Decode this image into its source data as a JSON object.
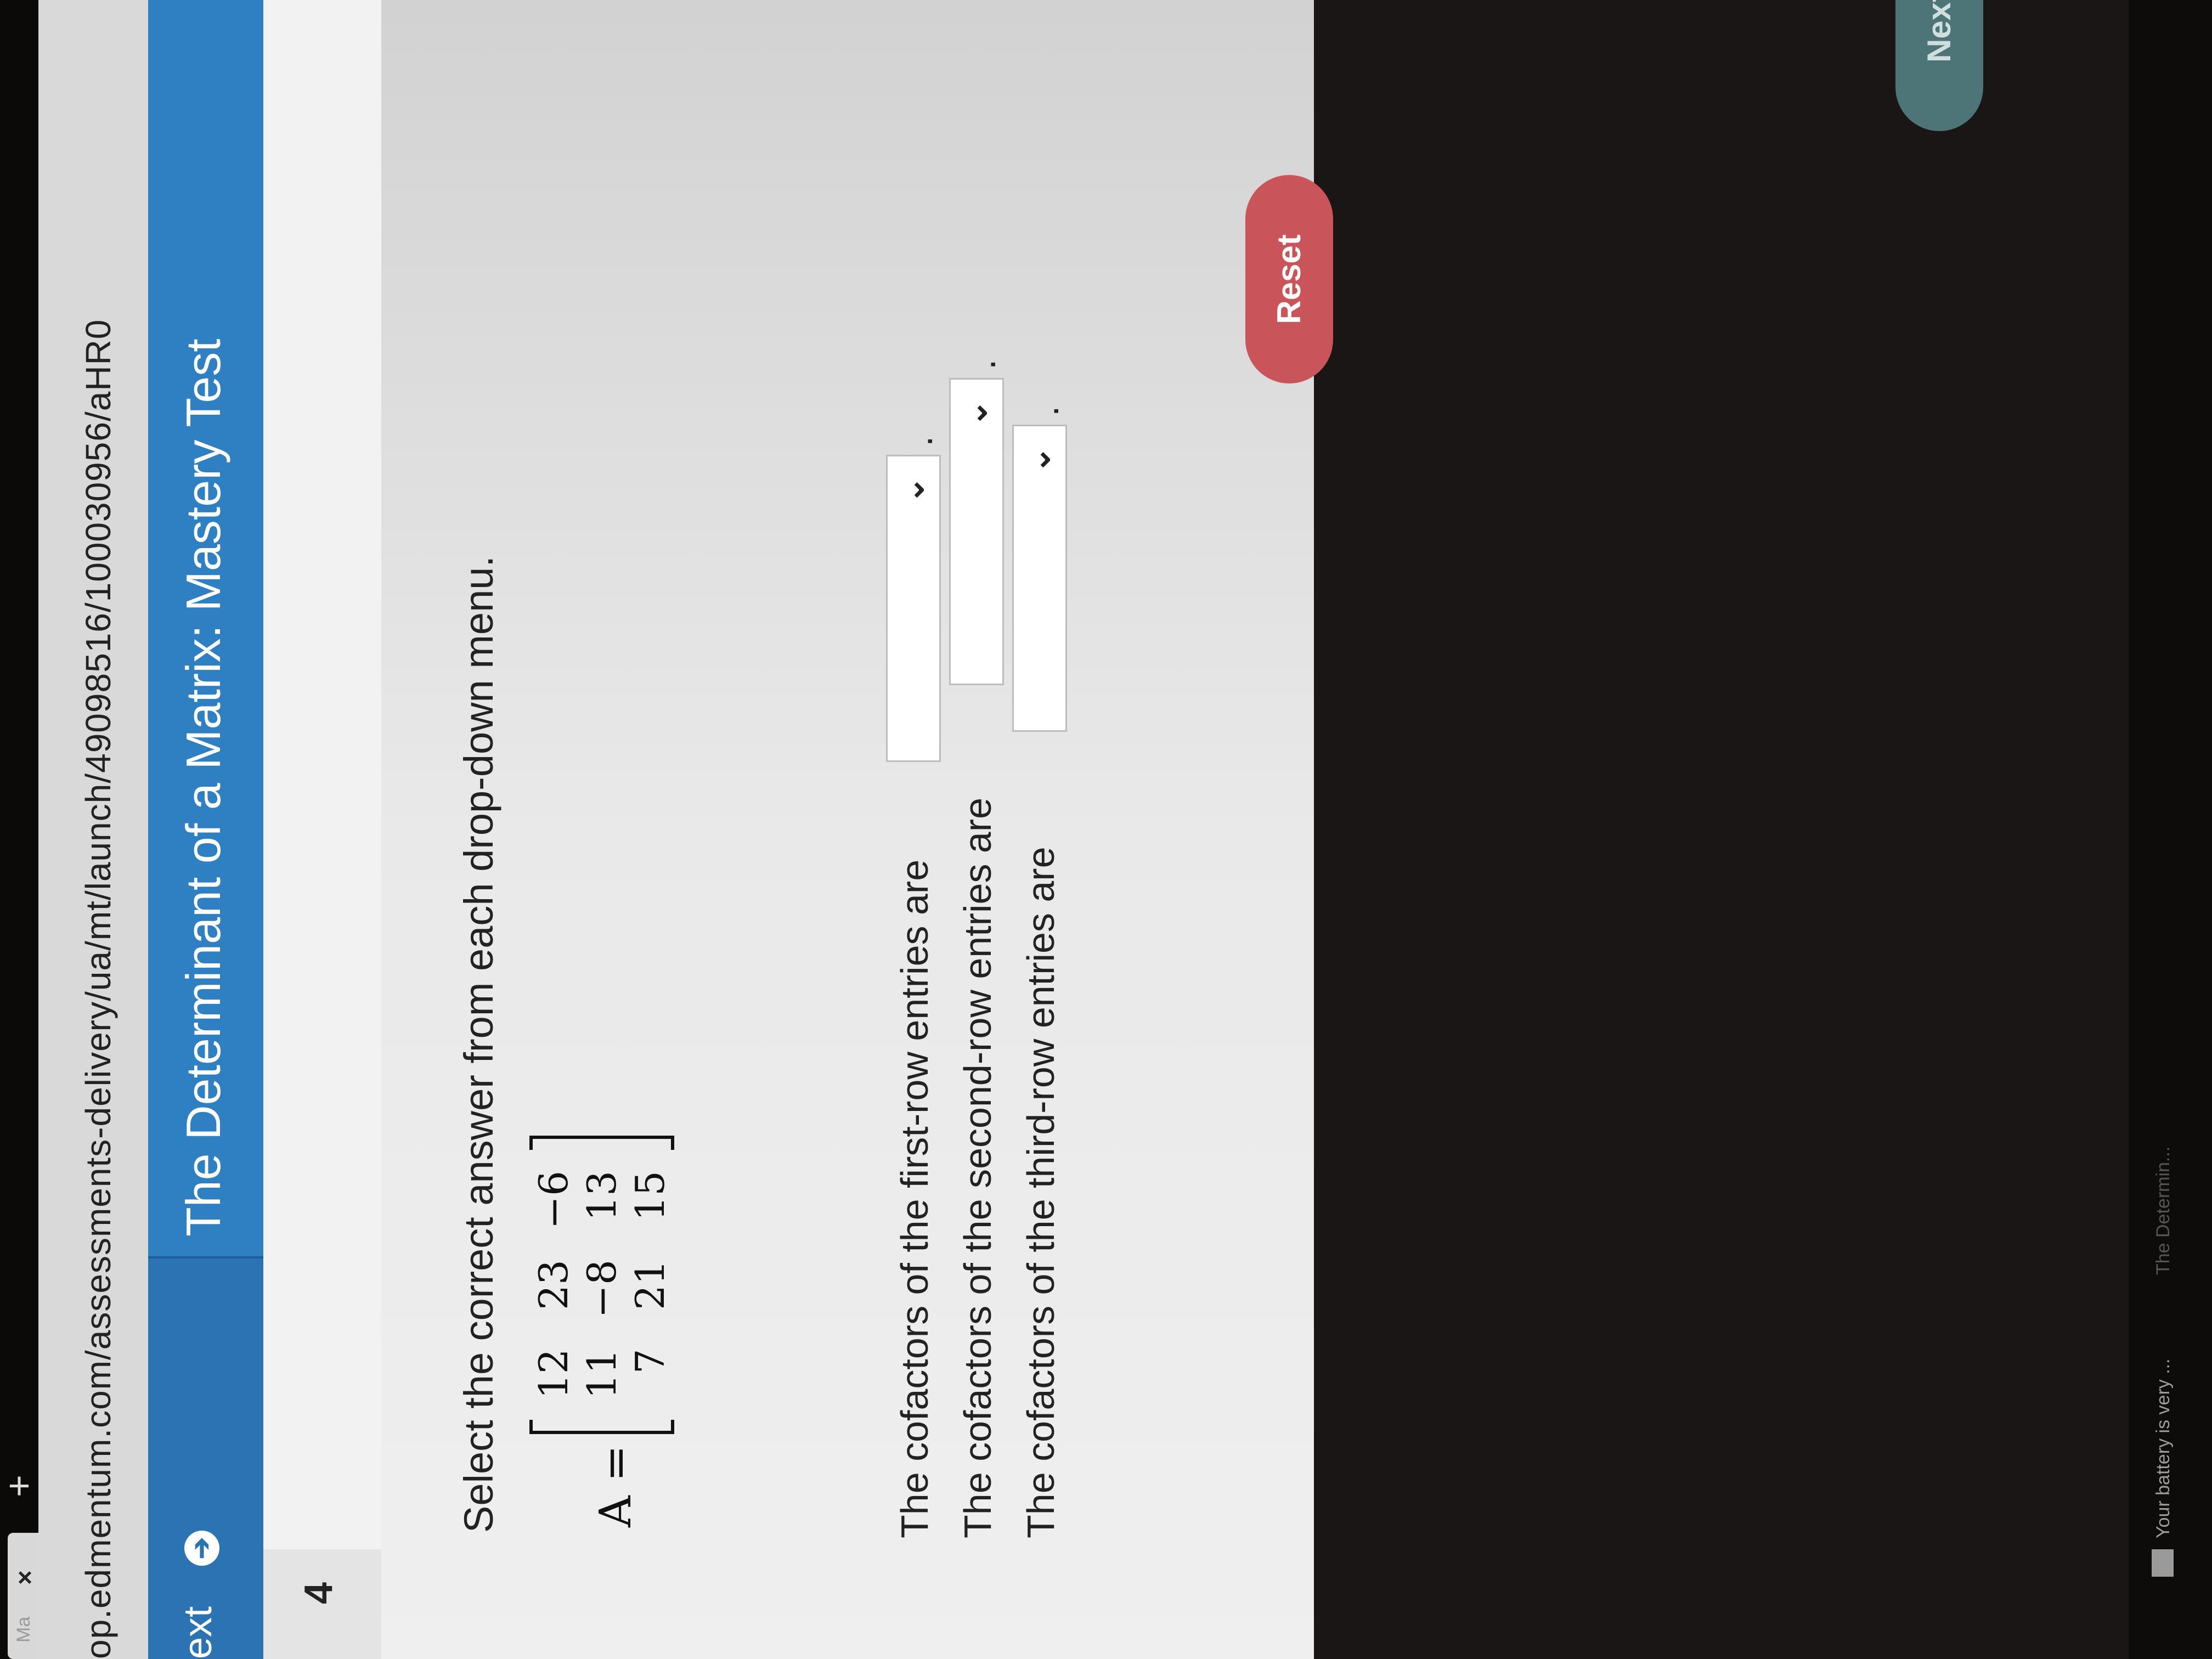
{
  "browser": {
    "tab_title": "Ma",
    "tab_close": "×",
    "new_tab": "+",
    "url": "op.edmentum.com/assessments-delivery/ua/mt/launch/49098516/100030956/aHR0"
  },
  "header": {
    "next_link": "ext",
    "title": "The Determinant of a Matrix: Mastery Test"
  },
  "question": {
    "number": "4",
    "instruction": "Select the correct answer from each drop-down menu.",
    "matrix_label": "A =",
    "matrix": [
      [
        "12",
        "23",
        "−6"
      ],
      [
        "11",
        "−8",
        "13"
      ],
      [
        "7",
        "21",
        "15"
      ]
    ],
    "rows": [
      {
        "label": "The cofactors of the first-row entries are",
        "value": ""
      },
      {
        "label": "The cofactors of the second-row entries are",
        "value": ""
      },
      {
        "label": "The cofactors of the third-row entries are",
        "value": ""
      }
    ],
    "period": "."
  },
  "buttons": {
    "reset": "Reset",
    "next": "Next"
  },
  "taskbar": {
    "battery": "Your battery is very ...",
    "item": "The Determin..."
  },
  "colors": {
    "header_blue": "#2f7fc3",
    "reset_red": "#c9555a",
    "next_teal": "#4d7578"
  }
}
